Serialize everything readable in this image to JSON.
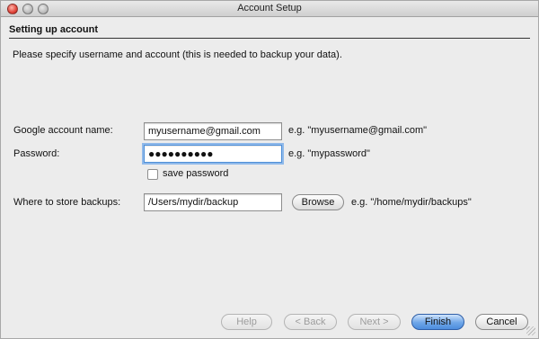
{
  "window": {
    "title": "Account Setup"
  },
  "section": {
    "header": "Setting up account"
  },
  "intro_text": "Please specify username and account (this is needed to backup your data).",
  "form": {
    "account": {
      "label": "Google account name:",
      "value": "myusername@gmail.com",
      "example": "e.g. \"myusername@gmail.com\""
    },
    "password": {
      "label": "Password:",
      "masked_value": "●●●●●●●●●●",
      "example": "e.g. \"mypassword\""
    },
    "save_password": {
      "label": "save password",
      "checked": false
    },
    "backup_location": {
      "label": "Where to store backups:",
      "value": "/Users/mydir/backup",
      "browse_label": "Browse",
      "example": "e.g. \"/home/mydir/backups\""
    }
  },
  "footer": {
    "help_label": "Help",
    "back_label": "< Back",
    "next_label": "Next >",
    "finish_label": "Finish",
    "cancel_label": "Cancel"
  },
  "colors": {
    "focus_ring": "#8fb9ea",
    "default_button": "#6ea6e8",
    "disabled_text": "#9c9c9c"
  }
}
